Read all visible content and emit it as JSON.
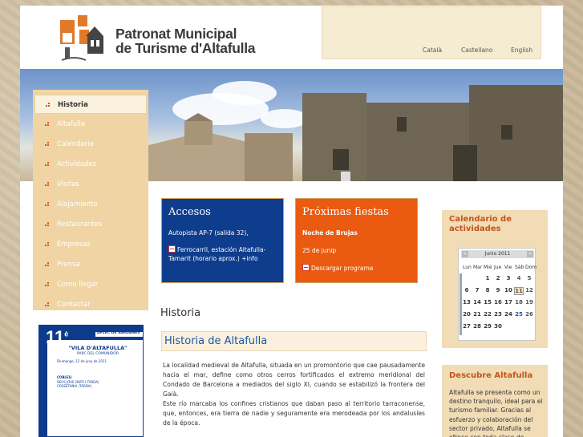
{
  "brand": {
    "line1": "Patronat Municipal",
    "line2": "de Turisme d'Altafulla"
  },
  "languages": [
    "Català",
    "Castellano",
    "English"
  ],
  "menu": [
    {
      "label": "Historia",
      "active": true
    },
    {
      "label": "Altafulla"
    },
    {
      "label": "Calendario"
    },
    {
      "label": "Actividades"
    },
    {
      "label": "Visitas"
    },
    {
      "label": "Alojamiento"
    },
    {
      "label": "Restaurantes"
    },
    {
      "label": "Empresas"
    },
    {
      "label": "Prensa"
    },
    {
      "label": "Como llegar"
    },
    {
      "label": "Contactar"
    }
  ],
  "poster": {
    "number": "11",
    "sup": "è",
    "line1": "APLEC DE SARDANES",
    "title": "\"VILA D'ALTAFULLA\"",
    "place": "PARC DEL COMUNIDOR",
    "date": "Diumenge, 12 de juny de 2011",
    "coblas_head": "COBLES:",
    "coblas": "REUS JOVE (MATI I TARDA)\nCOSSETANIA (TARDA)"
  },
  "accesos": {
    "title": "Accesos",
    "line1": "Autopista AP-7 (salida 32),",
    "line2": "Ferrocarril, estación Altafulla-Tamarit (horario aprox.) +info"
  },
  "fiestas": {
    "title": "Próximas fiestas",
    "event": "Noche de Brujas",
    "date": "25 de junip",
    "link": "Descargar programa"
  },
  "main": {
    "heading": "Historia",
    "subheading": "Historia de Altafulla",
    "para1": "La localidad medieval de Altafulla, situada en un promontorio que cae pausadamente hacia el mar, define como otros cerros fortificados el extremo meridional del Condado de Barcelona a mediados del siglo XI, cuando se estabilizó la frontera del Gaià.",
    "para2": "Este río marcaba los confines cristianos que daban paso al territorio tarraconense, que, entonces, era tierra de nadie y seguramente era merodeada por los andalusíes de la época."
  },
  "calendar": {
    "title": "Calendario de actividades",
    "month": "Junio 2011",
    "prev": "«",
    "next": "»",
    "dow": [
      "Lun",
      "Mar",
      "Mié",
      "Jue",
      "Vie",
      "Sáb",
      "Dom"
    ],
    "weeks": [
      [
        "",
        "",
        "1",
        "2",
        "3",
        "4",
        "5"
      ],
      [
        "6",
        "7",
        "8",
        "9",
        "10",
        "11",
        "12"
      ],
      [
        "13",
        "14",
        "15",
        "16",
        "17",
        "18",
        "19"
      ],
      [
        "20",
        "21",
        "22",
        "23",
        "24",
        "25",
        "26"
      ],
      [
        "27",
        "28",
        "29",
        "30",
        "",
        "",
        ""
      ]
    ],
    "today": "11",
    "highlight": "25"
  },
  "discover": {
    "title": "Descubre Altafulla",
    "text": "Altafulla se presenta como un destino tranquilo, ideal para el turismo familiar. Gracias al esfuerzo y colaboración del sector privado, Altafulla se ofrece con toda clase de"
  },
  "colors": {
    "accent": "#c2551a",
    "blue": "#0f3d8d",
    "orange": "#ea5b11",
    "link": "#1a57a5"
  }
}
